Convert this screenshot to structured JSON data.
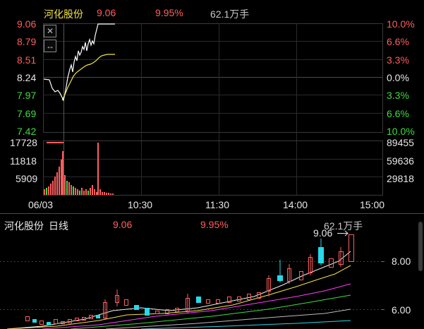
{
  "intraday": {
    "name": "河化股份",
    "price": "9.06",
    "pct": "9.95%",
    "volume": "62.1万手",
    "price_labels": [
      "9.06",
      "8.79",
      "8.51",
      "8.24",
      "7.97",
      "7.69",
      "7.42"
    ],
    "pct_labels": [
      "10.0%",
      "6.6%",
      "3.3%",
      "0.0%",
      "3.3%",
      "6.6%",
      "10.0%"
    ],
    "vol_left": [
      "17728",
      "11818",
      "5909"
    ],
    "vol_right": [
      "89455",
      "59636",
      "29818"
    ],
    "date": "06/03",
    "times": [
      "10:30",
      "11:30",
      "14:00",
      "15:00"
    ],
    "close_icon": "close-icon",
    "expand_icon": "horizontal-arrows-icon"
  },
  "kline": {
    "name": "河化股份",
    "period": "日线",
    "price": "9.06",
    "pct": "9.95%",
    "volume": "62.1万手",
    "annotation": "9.06",
    "right_labels": [
      "8.00",
      "6.00"
    ]
  },
  "colors": {
    "up": "#ff5e5e",
    "down": "#3fdc3f",
    "cyan": "#29d8e8",
    "price_line": "#ffffff",
    "avg_line": "#f2e24a",
    "grid": "#2b2b2b"
  }
}
